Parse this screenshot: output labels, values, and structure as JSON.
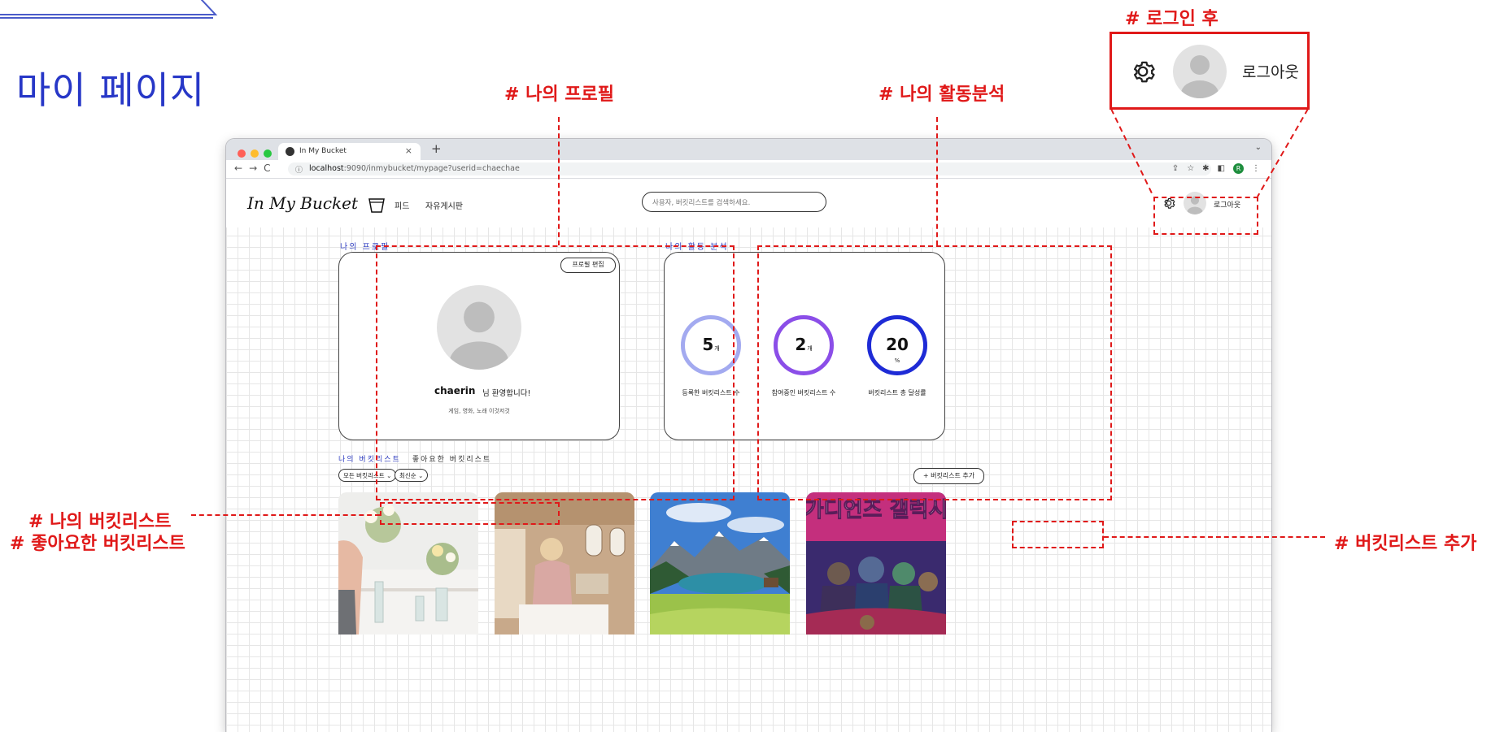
{
  "page_title": "마이 페이지",
  "annotations": {
    "login_after": "# 로그인 후",
    "my_profile": "# 나의 프로필",
    "my_activity": "# 나의 활동분석",
    "my_bucketlist": "# 나의 버킷리스트",
    "liked_bucketlist": "# 좋아요한 버킷리스트",
    "add_bucketlist": "# 버킷리스트 추가"
  },
  "login_zoom": {
    "logout_label": "로그아웃"
  },
  "browser": {
    "tab_title": "In My Bucket",
    "new_tab": "+",
    "close": "×",
    "url_host": "localhost",
    "url_path": ":9090/inmybucket/mypage?userid=chaechae"
  },
  "site": {
    "logo": "In My Bucket",
    "nav": [
      "피드",
      "자유게시판"
    ],
    "search_placeholder": "사용자, 버킷리스트를 검색하세요.",
    "logout_label": "로그아웃"
  },
  "profile": {
    "section_title": "나의 프로필",
    "edit_button": "프로필 편집",
    "username": "chaerin",
    "welcome": "님 환영합니다!",
    "interests": "게임, 영화, 노래 이것저것"
  },
  "activity": {
    "section_title": "나의 활동 분석",
    "stats": [
      {
        "value": "5",
        "unit": "개",
        "label": "등록한 버킷리스트 수",
        "color": "#a3aaf0"
      },
      {
        "value": "2",
        "unit": "개",
        "label": "참여중인 버킷리스트 수",
        "color": "#8b4ee8"
      },
      {
        "value": "20",
        "unit": "%",
        "label": "버킷리스트 총 달성률",
        "color": "#1e2bd6"
      }
    ]
  },
  "bucketlist": {
    "tab_mine": "나의 버킷리스트",
    "tab_liked": "좋아요한 버킷리스트",
    "filter_all": "모든 버킷리스트",
    "sort": "최신순",
    "add_button": "+ 버킷리스트 추가",
    "items": [
      {
        "image": "flowers"
      },
      {
        "image": "airplane"
      },
      {
        "image": "mountain-lake"
      },
      {
        "image": "movie-poster",
        "poster_text": "가디언즈 갤럭시"
      }
    ]
  },
  "colors": {
    "annotation": "#e01919",
    "accent": "#2737c7"
  }
}
